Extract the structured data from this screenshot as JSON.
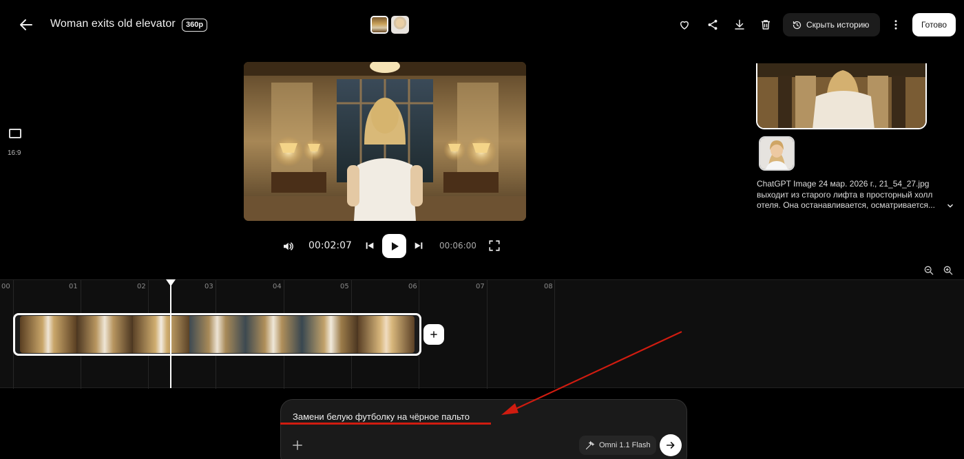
{
  "header": {
    "title": "Woman exits old elevator",
    "resolution": "360p",
    "history_label": "Скрыть историю",
    "done_label": "Готово"
  },
  "aspect": {
    "label": "16:9"
  },
  "player": {
    "current_time": "00:02:07",
    "total_time": "00:06:00"
  },
  "side_panel": {
    "filename": "ChatGPT Image 24 мар. 2026 г., 21_54_27.jpg",
    "description_line1": "выходит из старого лифта в просторный холл",
    "description_line2": "отеля. Она останавливается, осматривается..."
  },
  "timeline": {
    "ticks": [
      "00",
      "01",
      "02",
      "03",
      "04",
      "05",
      "06",
      "07",
      "08"
    ]
  },
  "prompt": {
    "text": "Замени белую футболку на чёрное пальто",
    "model": "Omni 1.1 Flash"
  },
  "colors": {
    "annotation_red": "#d01c10",
    "background": "#000000"
  }
}
